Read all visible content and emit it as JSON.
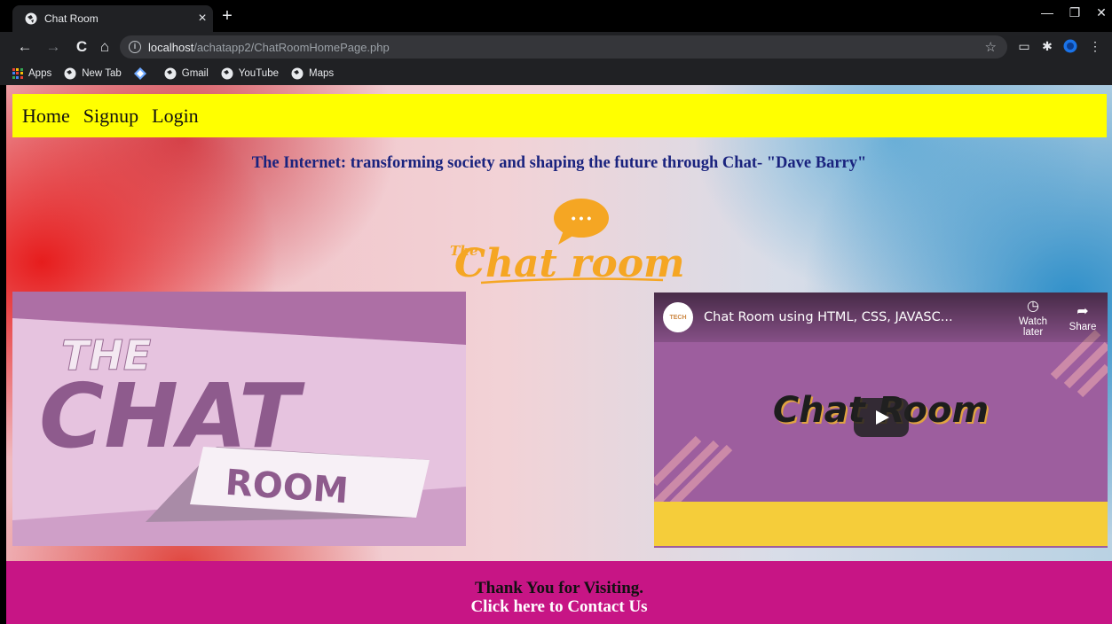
{
  "browser": {
    "tab_title": "Chat Room",
    "tab_close": "×",
    "new_tab": "+",
    "url_host": "localhost",
    "url_path": "/achatapp2/ChatRoomHomePage.php",
    "bookmarks": {
      "apps": "Apps",
      "new_tab": "New Tab",
      "gmail": "Gmail",
      "youtube": "YouTube",
      "maps": "Maps"
    }
  },
  "nav": {
    "home": "Home",
    "signup": "Signup",
    "login": "Login"
  },
  "quote": "The Internet: transforming society and shaping the future through Chat- \"Dave Barry\"",
  "logo": {
    "small": "The",
    "main": "Chat room",
    "bubble": "• • •"
  },
  "left_image": {
    "line1": "THE",
    "line2": "CHAT",
    "line3": "ROOM"
  },
  "video": {
    "channel": "TECH",
    "title": "Chat Room using HTML, CSS, JAVASC...",
    "watch_later": "Watch later",
    "share": "Share",
    "heading": "Chat Room"
  },
  "footer": {
    "thanks": "Thank You for Visiting.",
    "contact": "Click here to Contact Us"
  },
  "colors": {
    "navbar": "#ffff00",
    "footer": "#c71585",
    "quote": "#1a237e",
    "logo": "#f5a623"
  }
}
